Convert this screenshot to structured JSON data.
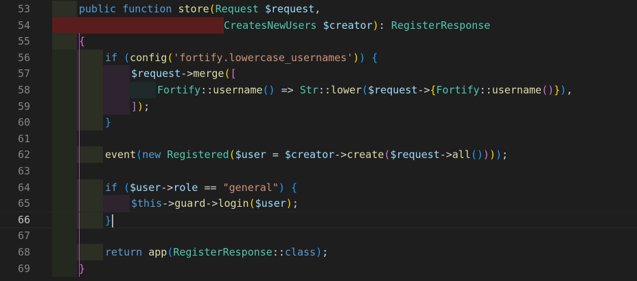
{
  "editor": {
    "line_numbers": [
      "53",
      "54",
      "55",
      "56",
      "57",
      "58",
      "59",
      "60",
      "61",
      "62",
      "63",
      "64",
      "65",
      "66",
      "67",
      "68",
      "69"
    ],
    "active_line": "66",
    "lines": [
      [
        [
          "kw",
          "public "
        ],
        [
          "kw",
          "function "
        ],
        [
          "fn",
          "store"
        ],
        [
          "b1",
          "("
        ],
        [
          "cls",
          "Request "
        ],
        [
          "var",
          "$request"
        ],
        [
          "pl",
          ","
        ]
      ],
      [
        [
          "cls",
          "CreatesNewUsers "
        ],
        [
          "var",
          "$creator"
        ],
        [
          "b1",
          ")"
        ],
        [
          "pl",
          ": "
        ],
        [
          "cls",
          "RegisterResponse"
        ]
      ],
      [
        [
          "b2",
          "{"
        ]
      ],
      [
        [
          "kw",
          "if "
        ],
        [
          "b3",
          "("
        ],
        [
          "fn",
          "config"
        ],
        [
          "b1",
          "("
        ],
        [
          "str",
          "'fortify.lowercase_usernames'"
        ],
        [
          "b1",
          ")"
        ],
        [
          "b3",
          ")"
        ],
        [
          "pl",
          " "
        ],
        [
          "b3",
          "{"
        ]
      ],
      [
        [
          "var",
          "$request"
        ],
        [
          "pl",
          "->"
        ],
        [
          "fn",
          "merge"
        ],
        [
          "b1",
          "("
        ],
        [
          "b2",
          "["
        ]
      ],
      [
        [
          "cls",
          "Fortify"
        ],
        [
          "pl",
          "::"
        ],
        [
          "fn",
          "username"
        ],
        [
          "b3",
          "()"
        ],
        [
          "pl",
          " => "
        ],
        [
          "cls",
          "Str"
        ],
        [
          "pl",
          "::"
        ],
        [
          "fn",
          "lower"
        ],
        [
          "b3",
          "("
        ],
        [
          "var",
          "$request"
        ],
        [
          "pl",
          "->"
        ],
        [
          "b1",
          "{"
        ],
        [
          "cls",
          "Fortify"
        ],
        [
          "pl",
          "::"
        ],
        [
          "fn",
          "username"
        ],
        [
          "b2",
          "()"
        ],
        [
          "b1",
          "}"
        ],
        [
          "b3",
          ")"
        ],
        [
          "pl",
          ","
        ]
      ],
      [
        [
          "b2",
          "]"
        ],
        [
          "b1",
          ")"
        ],
        [
          "pl",
          ";"
        ]
      ],
      [
        [
          "b3",
          "}"
        ]
      ],
      [],
      [
        [
          "fn",
          "event"
        ],
        [
          "b3",
          "("
        ],
        [
          "kw",
          "new "
        ],
        [
          "cls",
          "Registered"
        ],
        [
          "b1",
          "("
        ],
        [
          "var",
          "$user"
        ],
        [
          "pl",
          " = "
        ],
        [
          "var",
          "$creator"
        ],
        [
          "pl",
          "->"
        ],
        [
          "fn",
          "create"
        ],
        [
          "b2",
          "("
        ],
        [
          "var",
          "$request"
        ],
        [
          "pl",
          "->"
        ],
        [
          "fn",
          "all"
        ],
        [
          "b3",
          "()"
        ],
        [
          "b2",
          ")"
        ],
        [
          "b1",
          ")"
        ],
        [
          "b3",
          ")"
        ],
        [
          "pl",
          ";"
        ]
      ],
      [],
      [
        [
          "kw",
          "if "
        ],
        [
          "b3",
          "("
        ],
        [
          "var",
          "$user"
        ],
        [
          "pl",
          "->"
        ],
        [
          "var",
          "role"
        ],
        [
          "pl",
          " == "
        ],
        [
          "str",
          "\"general\""
        ],
        [
          "b3",
          ")"
        ],
        [
          "pl",
          " "
        ],
        [
          "b3",
          "{"
        ]
      ],
      [
        [
          "kw",
          "$this"
        ],
        [
          "pl",
          "->"
        ],
        [
          "fn",
          "guard"
        ],
        [
          "pl",
          "->"
        ],
        [
          "fn",
          "login"
        ],
        [
          "b1",
          "("
        ],
        [
          "var",
          "$user"
        ],
        [
          "b1",
          ")"
        ],
        [
          "pl",
          ";"
        ]
      ],
      [
        [
          "b3",
          "}"
        ]
      ],
      [],
      [
        [
          "kw",
          "return "
        ],
        [
          "fn",
          "app"
        ],
        [
          "b3",
          "("
        ],
        [
          "cls",
          "RegisterResponse"
        ],
        [
          "pl",
          "::"
        ],
        [
          "kw",
          "class"
        ],
        [
          "b3",
          ")"
        ],
        [
          "pl",
          ";"
        ]
      ],
      [
        [
          "b2",
          "}"
        ]
      ]
    ]
  }
}
